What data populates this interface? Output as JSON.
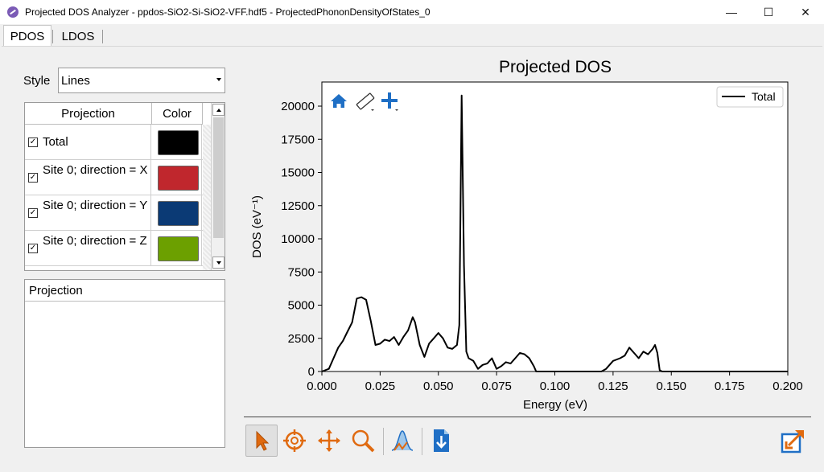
{
  "window": {
    "title": "Projected DOS Analyzer - ppdos-SiO2-Si-SiO2-VFF.hdf5 - ProjectedPhononDensityOfStates_0",
    "minimize": "—",
    "maximize": "☐",
    "close": "✕"
  },
  "tabs": [
    {
      "label": "PDOS",
      "active": true
    },
    {
      "label": "LDOS",
      "active": false
    }
  ],
  "style": {
    "label": "Style",
    "value": "Lines"
  },
  "projection_table": {
    "headers": [
      "Projection",
      "Color"
    ],
    "rows": [
      {
        "checked": true,
        "label": "Total",
        "color": "#000000"
      },
      {
        "checked": true,
        "label": "Site 0; direction = X",
        "color": "#c0272d"
      },
      {
        "checked": true,
        "label": "Site 0; direction = Y",
        "color": "#0b3a75"
      },
      {
        "checked": true,
        "label": "Site 0; direction = Z",
        "color": "#6ca000"
      }
    ]
  },
  "projection_panel": {
    "header": "Projection"
  },
  "chart_data": {
    "type": "line",
    "title": "Projected DOS",
    "xlabel": "Energy (eV)",
    "ylabel": "DOS (eV⁻¹)",
    "xlim": [
      0.0,
      0.2
    ],
    "ylim": [
      0,
      21000
    ],
    "xticks": [
      "0.000",
      "0.025",
      "0.050",
      "0.075",
      "0.100",
      "0.125",
      "0.150",
      "0.175",
      "0.200"
    ],
    "yticks": [
      "0",
      "2500",
      "5000",
      "7500",
      "10000",
      "12500",
      "15000",
      "17500",
      "20000"
    ],
    "legend_position": "top-right",
    "series": [
      {
        "name": "Total",
        "color": "#000000",
        "x": [
          0.0,
          0.003,
          0.005,
          0.007,
          0.009,
          0.011,
          0.013,
          0.015,
          0.017,
          0.019,
          0.021,
          0.023,
          0.025,
          0.027,
          0.029,
          0.031,
          0.033,
          0.035,
          0.037,
          0.039,
          0.04,
          0.042,
          0.044,
          0.046,
          0.048,
          0.05,
          0.052,
          0.054,
          0.056,
          0.058,
          0.059,
          0.06,
          0.061,
          0.062,
          0.063,
          0.065,
          0.067,
          0.069,
          0.071,
          0.073,
          0.075,
          0.077,
          0.079,
          0.081,
          0.083,
          0.085,
          0.087,
          0.089,
          0.091,
          0.092,
          0.093,
          0.1,
          0.11,
          0.12,
          0.122,
          0.125,
          0.128,
          0.13,
          0.132,
          0.134,
          0.136,
          0.138,
          0.14,
          0.142,
          0.143,
          0.144,
          0.145,
          0.146,
          0.16,
          0.2
        ],
        "y": [
          0,
          200,
          1000,
          1800,
          2300,
          3000,
          3700,
          5500,
          5600,
          5400,
          3800,
          2000,
          2100,
          2400,
          2300,
          2600,
          2000,
          2600,
          3100,
          4100,
          3700,
          2000,
          1100,
          2100,
          2500,
          2900,
          2500,
          1800,
          1700,
          2000,
          3500,
          20800,
          8000,
          1500,
          1000,
          800,
          200,
          500,
          600,
          1000,
          200,
          400,
          700,
          600,
          1000,
          1400,
          1300,
          1000,
          400,
          0,
          0,
          0,
          0,
          0,
          200,
          800,
          1000,
          1200,
          1800,
          1400,
          1000,
          1500,
          1300,
          1700,
          2000,
          1400,
          100,
          0,
          0,
          0
        ]
      }
    ]
  },
  "plot_icons": {
    "home": "home-icon",
    "ruler": "ruler-icon",
    "crosshair": "plus-icon"
  },
  "bottom_toolbar": [
    "pointer-icon",
    "target-icon",
    "pan-icon",
    "zoom-icon",
    "peak-icon",
    "export-icon",
    "popout-icon"
  ]
}
